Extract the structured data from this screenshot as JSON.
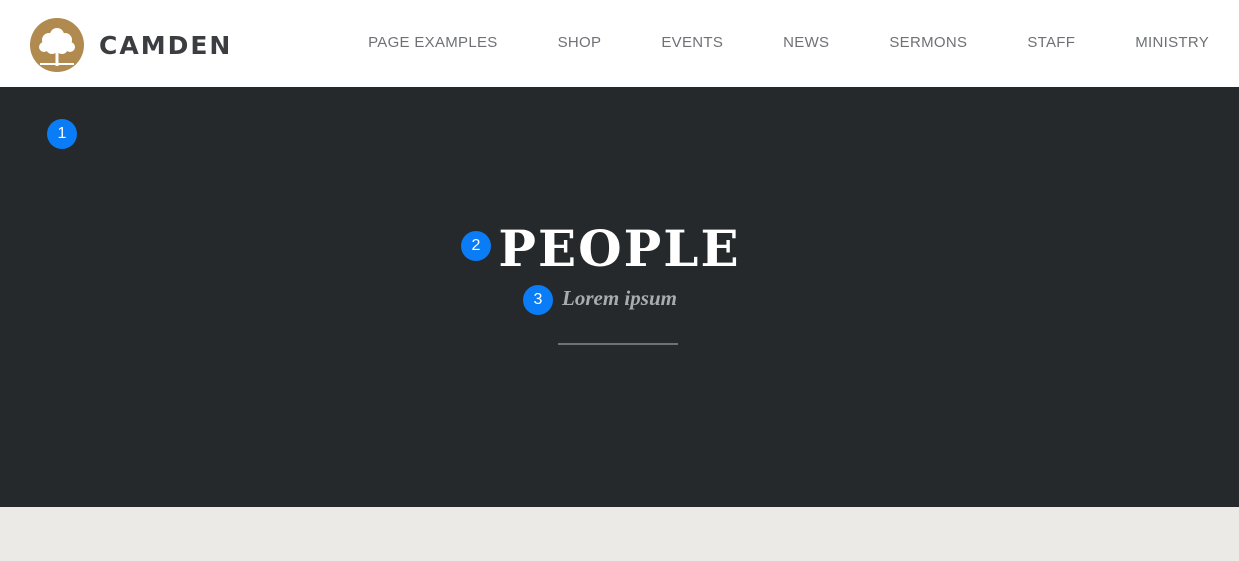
{
  "brand": {
    "name": "CAMDEN",
    "logo_icon": "tree-icon",
    "logo_color": "#b08a4f"
  },
  "nav": {
    "items": [
      {
        "label": "PAGE EXAMPLES"
      },
      {
        "label": "SHOP"
      },
      {
        "label": "EVENTS"
      },
      {
        "label": "NEWS"
      },
      {
        "label": "SERMONS"
      },
      {
        "label": "STAFF"
      },
      {
        "label": "MINISTRY"
      }
    ]
  },
  "hero": {
    "title": "PEOPLE",
    "subtitle": "Lorem ipsum",
    "background": "#25292b"
  },
  "markers": {
    "m1": "1",
    "m2": "2",
    "m3": "3",
    "color": "#0a7cf5"
  }
}
